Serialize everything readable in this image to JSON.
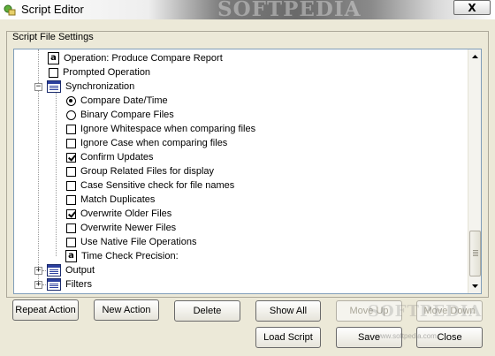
{
  "window": {
    "title": "Script Editor",
    "watermark": "SOFTPEDIA",
    "close_label": "X"
  },
  "group": {
    "label": "Script File Settings"
  },
  "tree": {
    "items": [
      {
        "label": "Operation: Produce Compare Report",
        "kind": "text-value"
      },
      {
        "label": "Prompted Operation",
        "kind": "checkbox",
        "checked": false
      },
      {
        "label": "Synchronization",
        "kind": "group",
        "expanded": true
      },
      {
        "label": "Compare Date/Time",
        "kind": "radio",
        "selected": true
      },
      {
        "label": "Binary Compare Files",
        "kind": "radio",
        "selected": false
      },
      {
        "label": "Ignore Whitespace when comparing files",
        "kind": "checkbox",
        "checked": false
      },
      {
        "label": "Ignore Case when comparing files",
        "kind": "checkbox",
        "checked": false
      },
      {
        "label": "Confirm Updates",
        "kind": "checkbox",
        "checked": true
      },
      {
        "label": "Group Related Files for display",
        "kind": "checkbox",
        "checked": false
      },
      {
        "label": "Case Sensitive check for file names",
        "kind": "checkbox",
        "checked": false
      },
      {
        "label": "Match Duplicates",
        "kind": "checkbox",
        "checked": false
      },
      {
        "label": "Overwrite Older Files",
        "kind": "checkbox",
        "checked": true
      },
      {
        "label": "Overwrite Newer Files",
        "kind": "checkbox",
        "checked": false
      },
      {
        "label": "Use Native File Operations",
        "kind": "checkbox",
        "checked": false
      },
      {
        "label": "Time Check Precision:",
        "kind": "text-value"
      },
      {
        "label": "Output",
        "kind": "group",
        "expanded": false
      },
      {
        "label": "Filters",
        "kind": "group",
        "expanded": false
      }
    ]
  },
  "buttons": {
    "repeat_action": "Repeat Action",
    "new_action": "New Action",
    "delete": "Delete",
    "show_all": "Show All",
    "move_up": "Move Up",
    "move_down": "Move Down",
    "load_script": "Load Script",
    "save": "Save",
    "close": "Close"
  },
  "footer_watermark": {
    "big": "SOFTPEDIA",
    "small": "www.softpedia.com"
  }
}
